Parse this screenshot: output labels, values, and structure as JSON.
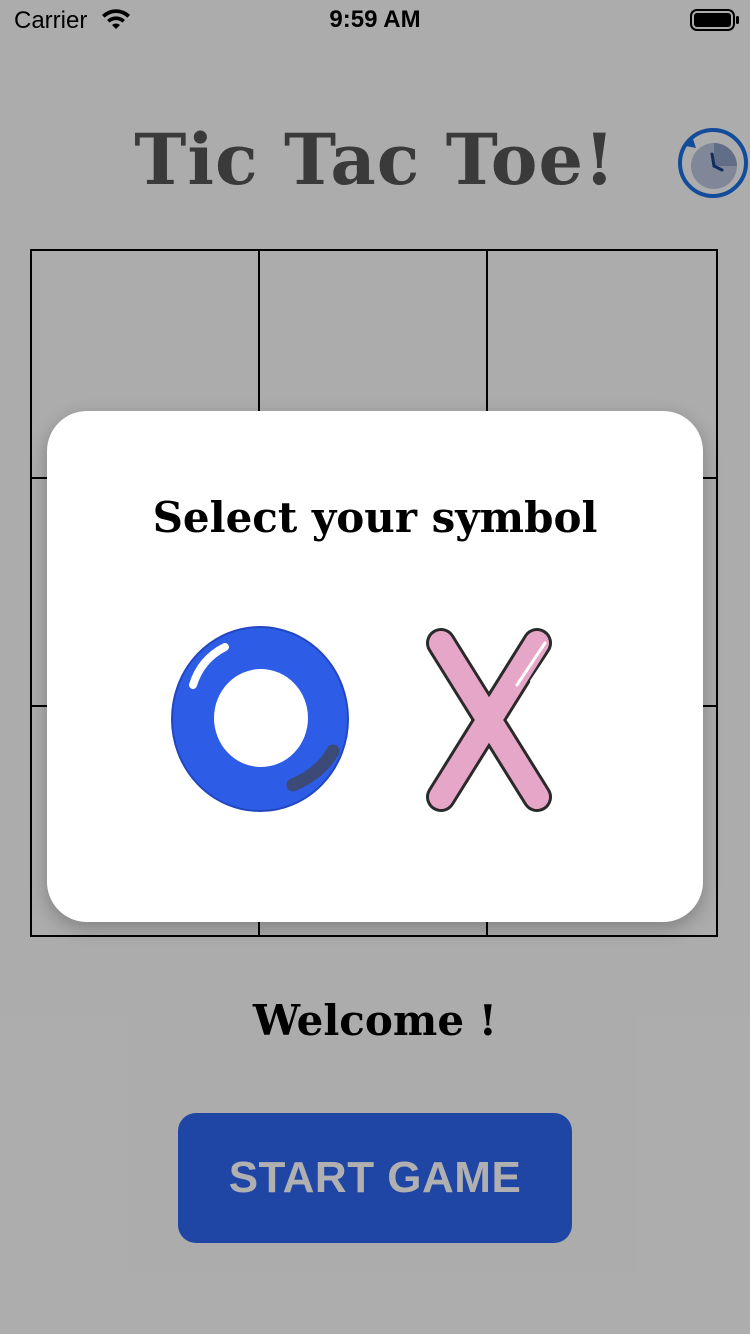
{
  "status_bar": {
    "carrier": "Carrier",
    "time": "9:59 AM"
  },
  "header": {
    "title": "Tic Tac Toe!"
  },
  "board": {
    "cells": [
      "",
      "",
      "",
      "",
      "",
      "",
      "",
      "",
      ""
    ]
  },
  "status": {
    "message": "Welcome !"
  },
  "actions": {
    "start_label": "START GAME"
  },
  "modal": {
    "title": "Select your symbol",
    "options": [
      {
        "symbol": "O",
        "color": "#2d5ce6"
      },
      {
        "symbol": "X",
        "color": "#e6a6c8"
      }
    ]
  },
  "colors": {
    "accent": "#2d64f0",
    "title": "#555555"
  }
}
